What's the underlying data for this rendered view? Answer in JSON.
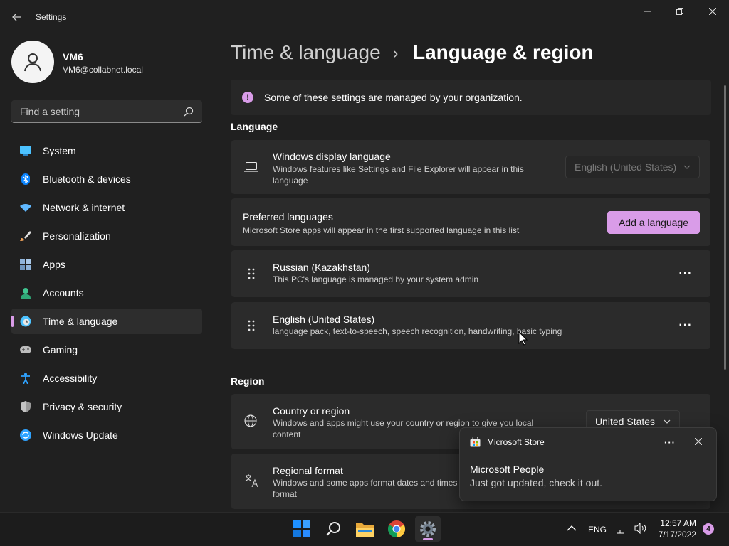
{
  "window": {
    "title": "Settings",
    "icons": {
      "back": "back-arrow-icon",
      "minimize": "minimize-icon",
      "maximize": "maximize-icon",
      "close": "close-icon"
    }
  },
  "profile": {
    "name": "VM6",
    "email": "VM6@collabnet.local"
  },
  "search": {
    "placeholder": "Find a setting"
  },
  "sidebar": {
    "items": [
      {
        "label": "System",
        "icon": "monitor-icon",
        "color": "#4cc2ff"
      },
      {
        "label": "Bluetooth & devices",
        "icon": "bluetooth-icon",
        "color": "#0a84ff"
      },
      {
        "label": "Network & internet",
        "icon": "wifi-icon",
        "color": "#60b8ff"
      },
      {
        "label": "Personalization",
        "icon": "brush-icon",
        "color": "#f1a35a"
      },
      {
        "label": "Apps",
        "icon": "apps-icon",
        "color": "#8fb3d9"
      },
      {
        "label": "Accounts",
        "icon": "person-icon",
        "color": "#3fc48f"
      },
      {
        "label": "Time & language",
        "icon": "globe-clock-icon",
        "color": "#4cc2ff",
        "active": true
      },
      {
        "label": "Gaming",
        "icon": "gamepad-icon",
        "color": "#bdbdbd"
      },
      {
        "label": "Accessibility",
        "icon": "accessibility-icon",
        "color": "#2fa3ff"
      },
      {
        "label": "Privacy & security",
        "icon": "shield-icon",
        "color": "#9a9a9a"
      },
      {
        "label": "Windows Update",
        "icon": "update-icon",
        "color": "#2fa3ff"
      }
    ]
  },
  "breadcrumb": {
    "parent": "Time & language",
    "separator": "›",
    "current": "Language & region"
  },
  "info_bar": {
    "text": "Some of these settings are managed by your organization.",
    "icon_glyph": "!"
  },
  "language_section": {
    "title": "Language",
    "display_language": {
      "title": "Windows display language",
      "desc_line1": "Windows features like Settings and File Explorer will appear in this",
      "desc_line2": "language",
      "value": "English (United States)"
    },
    "preferred": {
      "title": "Preferred languages",
      "desc": "Microsoft Store apps will appear in the first supported language in this list",
      "button": "Add a language"
    },
    "languages": [
      {
        "name": "Russian (Kazakhstan)",
        "desc": "This PC's language is managed by your system admin",
        "more": "···"
      },
      {
        "name": "English (United States)",
        "desc": "language pack, text-to-speech, speech recognition, handwriting, basic typing",
        "more": "···"
      }
    ]
  },
  "region_section": {
    "title": "Region",
    "country": {
      "title": "Country or region",
      "desc_line1": "Windows and apps might use your country or region to give you local",
      "desc_line2": "content",
      "value": "United States"
    },
    "format": {
      "title": "Regional format",
      "desc_line1": "Windows and some apps format dates and times",
      "desc_line2": "format"
    }
  },
  "toast": {
    "app": "Microsoft Store",
    "title": "Microsoft People",
    "body": "Just got updated, check it out.",
    "more": "···"
  },
  "taskbar": {
    "apps": [
      "windows-start-icon",
      "search-icon",
      "file-explorer-icon",
      "chrome-icon",
      "settings-gear-icon"
    ],
    "language": "ENG",
    "time": "12:57 AM",
    "date": "7/17/2022",
    "notification_count": "4"
  },
  "colors": {
    "accent": "#d99ce8",
    "background": "#202020",
    "card": "#2b2b2b"
  }
}
